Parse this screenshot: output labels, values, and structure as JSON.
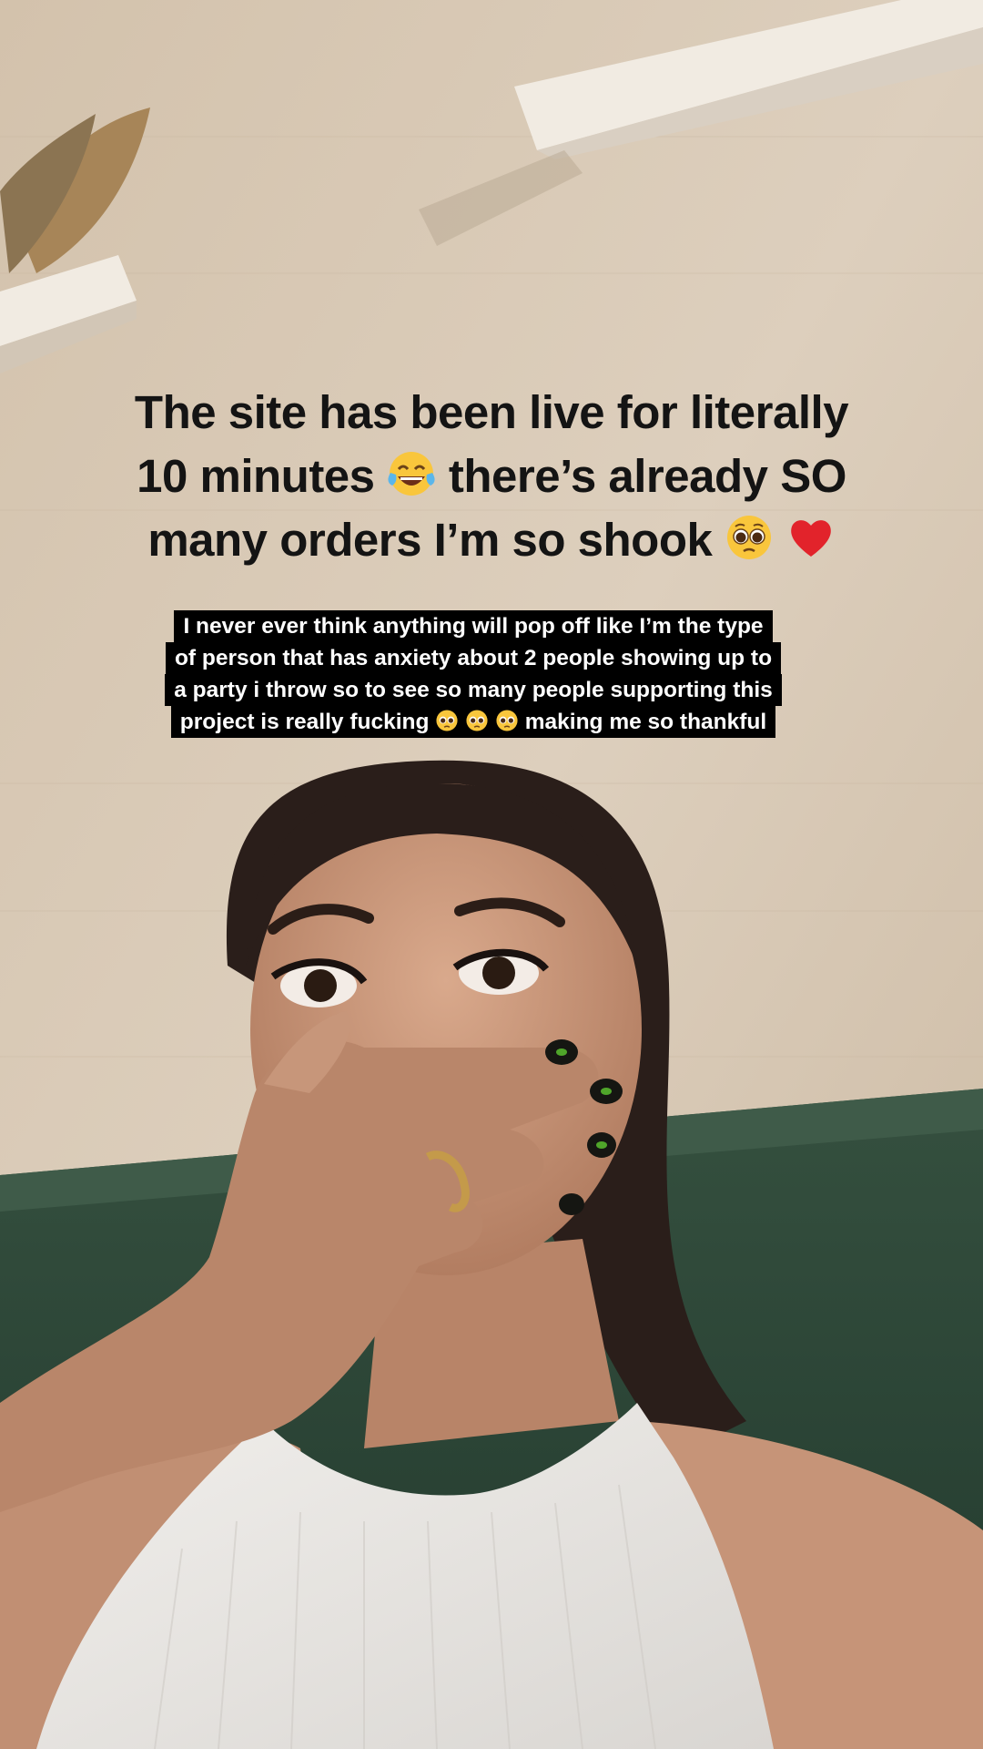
{
  "story": {
    "main_caption": {
      "lines": [
        {
          "text_a": "The site has been live for literally",
          "text_b": "",
          "text_c": ""
        },
        {
          "text_a": "10 minutes",
          "text_b": "there’s already SO",
          "text_c": ""
        },
        {
          "text_a": "many orders I’m so shook",
          "text_b": "",
          "text_c": ""
        }
      ],
      "emojis": [
        "tears-of-joy-emoji",
        "pleading-face-emoji",
        "red-heart-emoji"
      ]
    },
    "sub_caption": {
      "lines": [
        "I never ever think anything will pop off like I’m the type",
        "of person that has anxiety about 2 people showing up to",
        "a party i throw so to see so many people supporting this"
      ],
      "last_line_a": "project is really fucking",
      "last_line_b": "making me so thankful",
      "emojis": [
        "pleading-face-emoji",
        "pleading-face-emoji",
        "pleading-face-emoji"
      ]
    },
    "colors": {
      "wall": "#d8c9b5",
      "couch": "#2f4a3c",
      "caption_text": "#141414",
      "sub_caption_bg": "#000000",
      "sub_caption_text": "#ffffff"
    }
  }
}
